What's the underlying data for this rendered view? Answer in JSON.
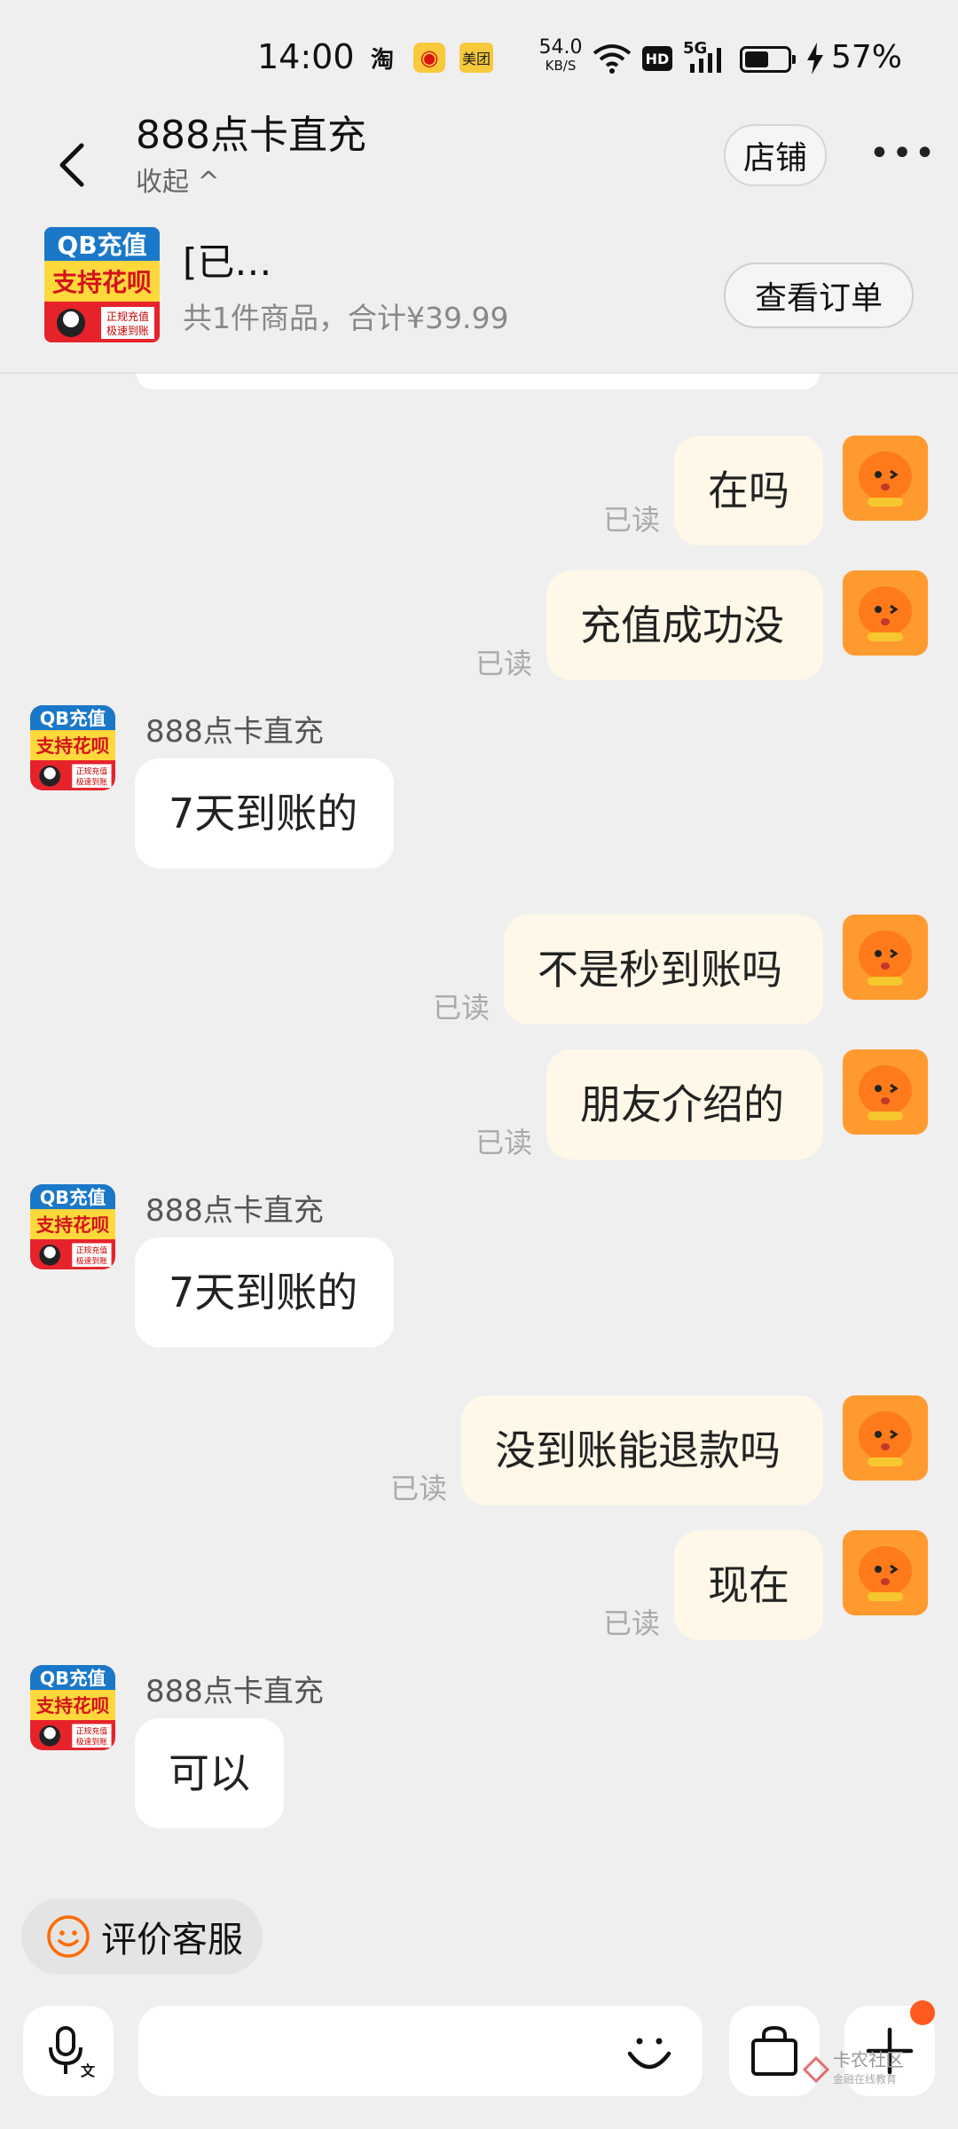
{
  "status_bar": {
    "time": "14:00",
    "app_icons": {
      "taobao": "淘",
      "weibo": "◉",
      "meituan": "美团"
    },
    "net_speed_value": "54.0",
    "net_speed_unit": "KB/S",
    "hd_label": "HD",
    "network_label": "5G",
    "battery_percent": "57%",
    "battery_level": 0.57
  },
  "header": {
    "shop_name": "888点卡直充",
    "collapse_label": "收起 ^",
    "store_button": "店铺",
    "more_button": "•••",
    "order": {
      "thumb_line1": "QB充值",
      "thumb_line2": "支持花呗",
      "thumb_line3": "正规充值",
      "thumb_line4": "极速到账",
      "title": "[已…",
      "summary": "共1件商品，合计¥39.99",
      "view_order_button": "查看订单"
    }
  },
  "shop_avatar": {
    "line1": "QB充值",
    "line2": "支持花呗",
    "line3": "正规充值",
    "line4": "极速到账"
  },
  "messages": [
    {
      "from": "me",
      "text": "在吗",
      "status": "已读"
    },
    {
      "from": "me",
      "text": "充值成功没",
      "status": "已读"
    },
    {
      "from": "shop",
      "sender": "888点卡直充",
      "text": "7天到账的"
    },
    {
      "from": "me",
      "text": "不是秒到账吗",
      "status": "已读"
    },
    {
      "from": "me",
      "text": "朋友介绍的",
      "status": "已读"
    },
    {
      "from": "shop",
      "sender": "888点卡直充",
      "text": "7天到账的"
    },
    {
      "from": "me",
      "text": "没到账能退款吗",
      "status": "已读"
    },
    {
      "from": "me",
      "text": "现在",
      "status": "已读"
    },
    {
      "from": "shop",
      "sender": "888点卡直充",
      "text": "可以"
    }
  ],
  "rate_button": {
    "label": "评价客服",
    "icon": "smile-icon"
  },
  "input_bar": {
    "voice_icon": "mic-icon",
    "voice_icon_sub": "文",
    "text_placeholder": "",
    "emoji_icon": "smile-icon",
    "bag_icon": "shopping-bag-icon",
    "plus_icon": "plus-icon"
  },
  "watermark": {
    "name": "卡农社区",
    "sub": "金融在线教育"
  },
  "colors": {
    "background": "#efefef",
    "my_bubble": "#fff8e8",
    "their_bubble": "#ffffff",
    "accent_orange": "#ff5a1f",
    "avatar_orange": "#ff9a2e"
  }
}
